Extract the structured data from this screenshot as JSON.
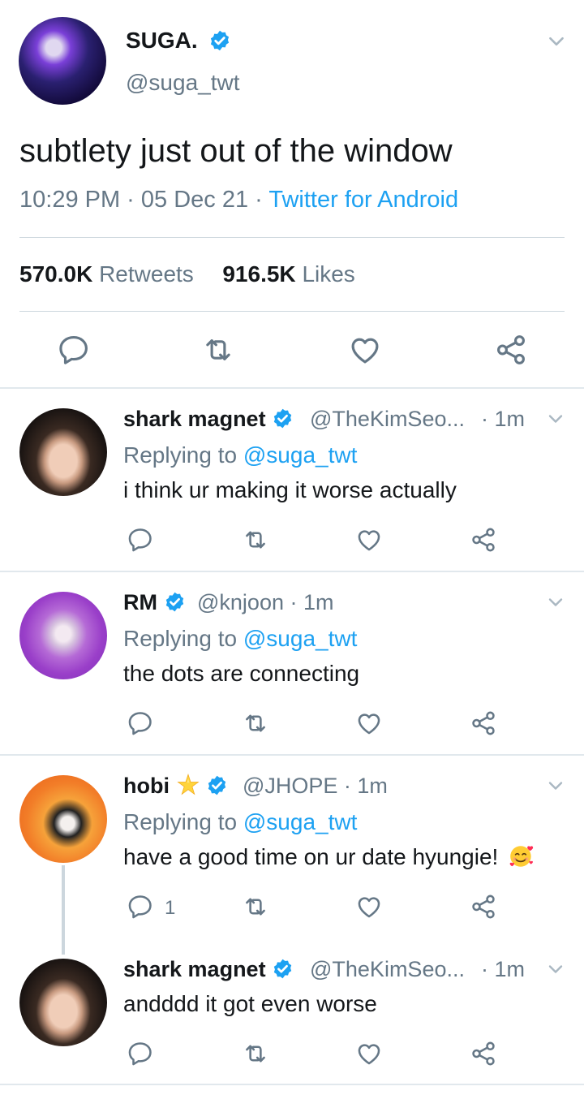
{
  "main": {
    "name": "SUGA.",
    "handle": "@suga_twt",
    "text": "subtlety just out of the window",
    "time": "10:29 PM · 05 Dec 21 · ",
    "client": "Twitter for Android",
    "retweets_count": "570.0K",
    "retweets_label": "Retweets",
    "likes_count": "916.5K",
    "likes_label": "Likes"
  },
  "replies": [
    {
      "name": "shark magnet",
      "handle": "@TheKimSeo...",
      "time": "· 1m",
      "replying_prefix": "Replying to ",
      "replying_to": "@suga_twt",
      "text": "i think ur making it worse actually"
    },
    {
      "name": "RM",
      "handle": "@knjoon · 1m",
      "replying_prefix": "Replying to ",
      "replying_to": "@suga_twt",
      "text": "the dots are connecting"
    },
    {
      "name": "hobi",
      "name_emoji": "star",
      "handle": "@JHOPE · 1m",
      "replying_prefix": "Replying to ",
      "replying_to": "@suga_twt",
      "text": "have a good time on ur date hyungie!",
      "text_emoji": "smiling-face-with-hearts",
      "reply_count": "1"
    },
    {
      "name": "shark magnet",
      "handle": "@TheKimSeo...",
      "time": "· 1m",
      "text": "andddd it got even worse"
    }
  ],
  "colors": {
    "accent": "#1da1f2",
    "secondary_text": "#657786",
    "icon": "#657786",
    "divider": "#e1e8ed"
  },
  "icons": [
    "verified-icon",
    "chevron-down-icon",
    "reply-icon",
    "retweet-icon",
    "like-icon",
    "share-icon",
    "star-emoji",
    "smiling-face-with-hearts-emoji"
  ]
}
